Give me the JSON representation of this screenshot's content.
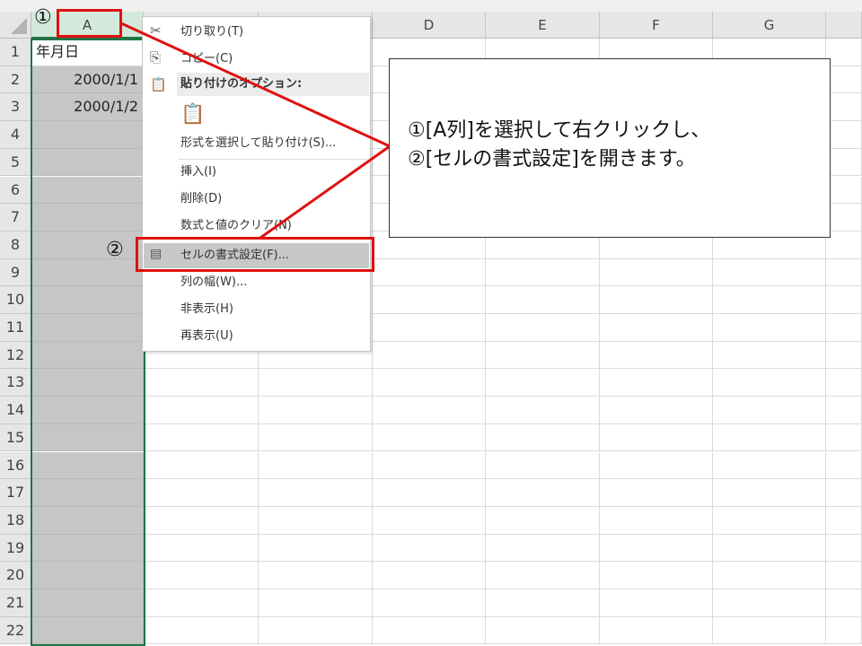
{
  "columns": [
    "A",
    "",
    "",
    "D",
    "E",
    "F",
    "G"
  ],
  "rows": [
    "1",
    "2",
    "3",
    "4",
    "5",
    "6",
    "7",
    "8",
    "9",
    "10",
    "11",
    "12",
    "13",
    "14",
    "15",
    "16",
    "17",
    "18",
    "19",
    "20",
    "21",
    "22"
  ],
  "cells": {
    "A1": "年月日",
    "A2": "2000/1/1",
    "A3": "2000/1/2"
  },
  "menu": {
    "cut": "切り取り(T)",
    "copy": "コピー(C)",
    "paste_options": "貼り付けのオプション:",
    "paste_special": "形式を選択して貼り付け(S)...",
    "insert": "挿入(I)",
    "delete": "削除(D)",
    "clear": "数式と値のクリア(N)",
    "format_cells": "セルの書式設定(F)...",
    "column_width": "列の幅(W)...",
    "hide": "非表示(H)",
    "unhide": "再表示(U)"
  },
  "annotations": {
    "step1": "①",
    "step2": "②",
    "callout_line1": "①[A列]を選択して右クリックし、",
    "callout_line2": "②[セルの書式設定]を開きます。"
  },
  "colors": {
    "highlight": "#e01010",
    "selected_header": "#d3e9dc",
    "selection_border": "#217346"
  }
}
